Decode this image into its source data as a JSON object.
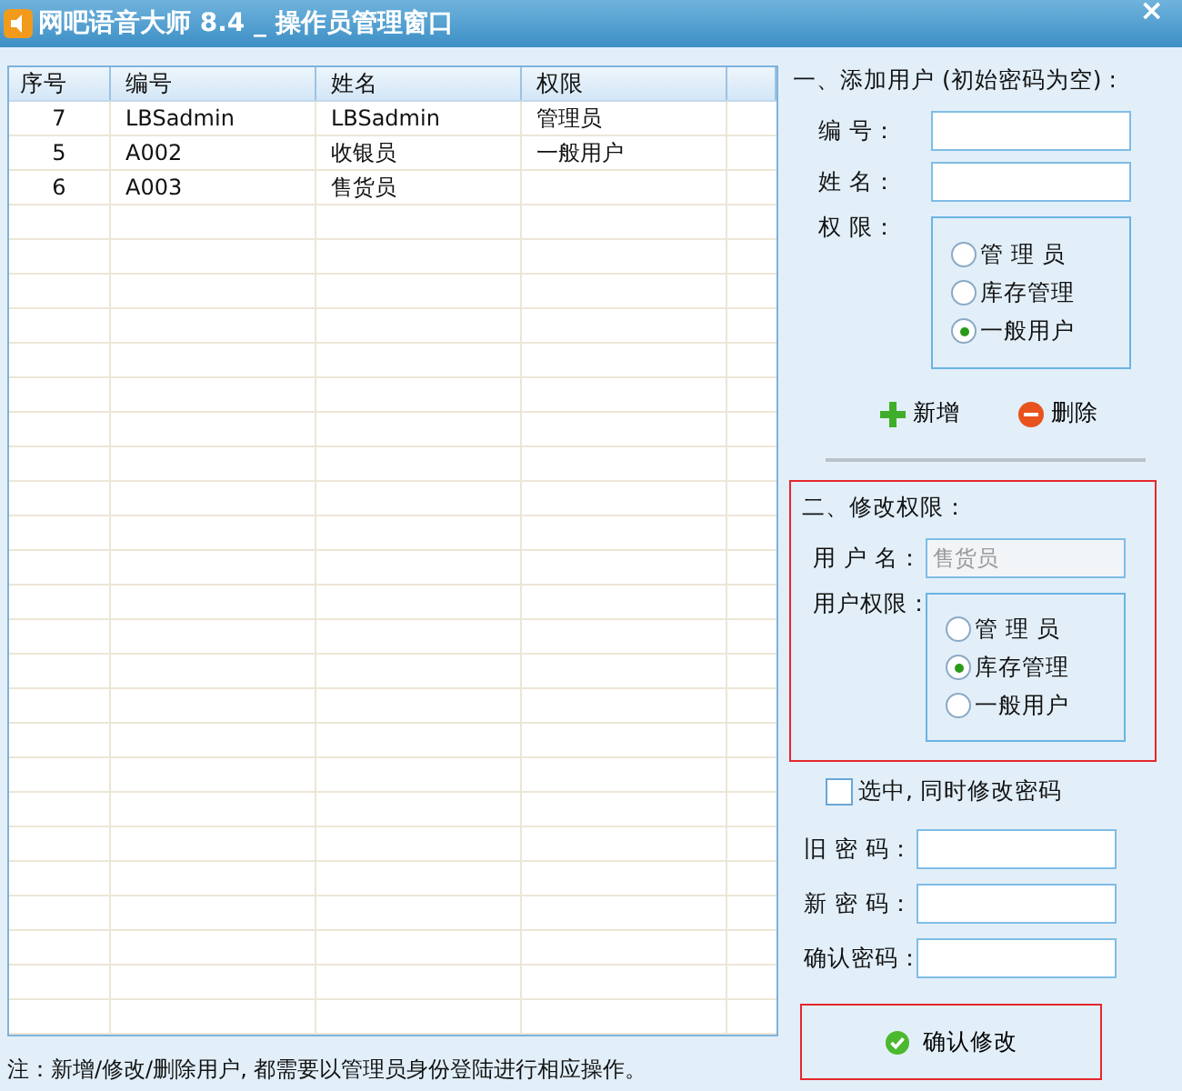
{
  "window": {
    "title": "网吧语音大师 8.4 _ 操作员管理窗口",
    "close": "×"
  },
  "table": {
    "columns": [
      "序号",
      "编号",
      "姓名",
      "权限"
    ],
    "rows": [
      {
        "cells": [
          "7",
          "LBSadmin",
          "LBSadmin",
          "管理员"
        ]
      },
      {
        "cells": [
          "5",
          "A002",
          "收银员",
          "一般用户"
        ]
      },
      {
        "cells": [
          "6",
          "A003",
          "售货员",
          null
        ]
      }
    ]
  },
  "add_user": {
    "title": "一、添加用户 (初始密码为空) :",
    "fields": [
      {
        "label": "编 号："
      },
      {
        "label": "姓 名："
      }
    ],
    "role_label": "权 限：",
    "roles": [
      {
        "label": "管 理 员",
        "selected": false
      },
      {
        "label": "库存管理",
        "selected": false
      },
      {
        "label": "一般用户",
        "selected": true
      }
    ],
    "buttons": [
      {
        "kind": "add",
        "label": "新增"
      },
      {
        "kind": "delete",
        "label": "删除"
      }
    ]
  },
  "modify": {
    "title": "二、修改权限：",
    "highlighted": true,
    "user_label": "用 户 名：",
    "user_value": "售货员",
    "disabled": true,
    "role_label": "用户权限：",
    "roles": [
      {
        "label": "管 理 员",
        "selected": false
      },
      {
        "label": "库存管理",
        "selected": true
      },
      {
        "label": "一般用户",
        "selected": false
      }
    ]
  },
  "change_password": {
    "label": "选中, 同时修改密码",
    "checked": false
  },
  "password_fields": [
    {
      "label": "旧 密 码："
    },
    {
      "label": "新 密 码："
    },
    {
      "label": "确认密码："
    }
  ],
  "confirm": {
    "label": "确认修改",
    "highlighted": true
  },
  "note": "注：新增/修改/删除用户, 都需要以管理员身份登陆进行相应操作。"
}
